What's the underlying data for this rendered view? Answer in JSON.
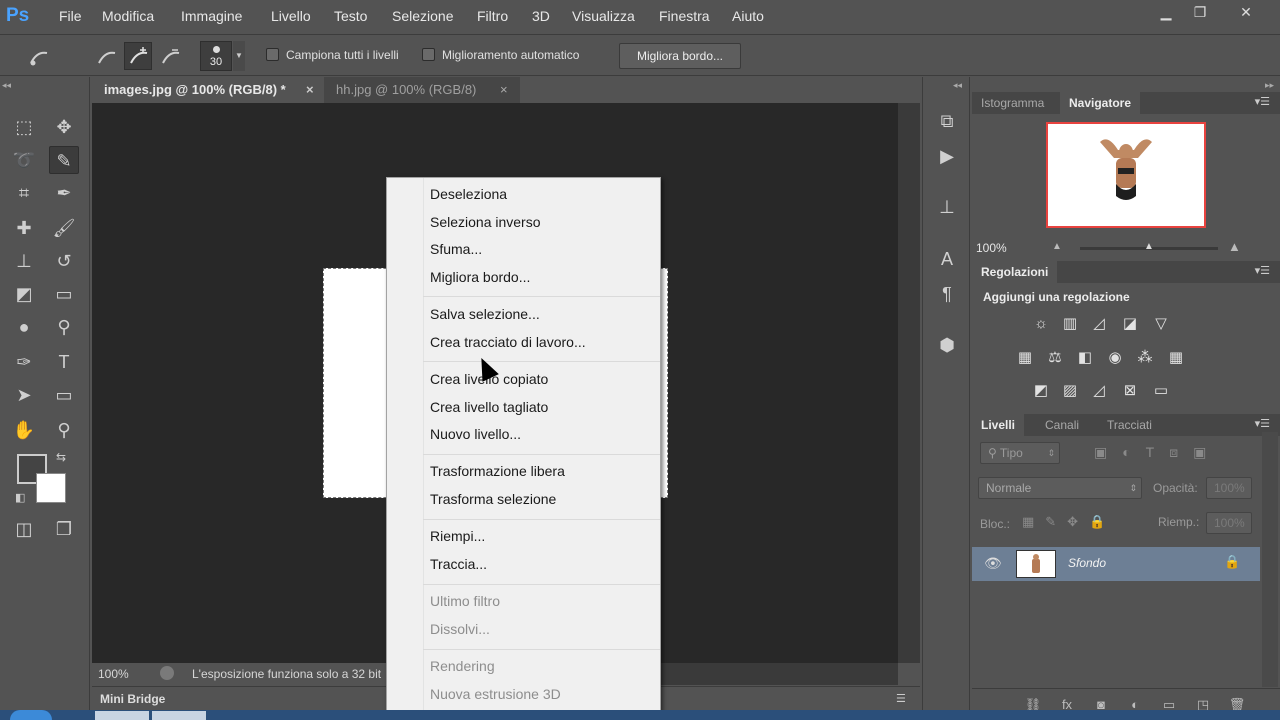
{
  "app": {
    "logo": "Ps"
  },
  "menubar": {
    "items": [
      "File",
      "Modifica",
      "Immagine",
      "Livello",
      "Testo",
      "Selezione",
      "Filtro",
      "3D",
      "Visualizza",
      "Finestra",
      "Aiuto"
    ]
  },
  "window_controls": {
    "minimize": "▁",
    "restore": "❐",
    "close": "✕"
  },
  "options": {
    "brush_size": "30",
    "sample_all_label": "Campiona tutti i livelli",
    "auto_enhance_label": "Miglioramento automatico",
    "refine_edge_button": "Migliora bordo..."
  },
  "tabs": [
    {
      "label": "images.jpg @ 100% (RGB/8) *",
      "close": "×"
    },
    {
      "label": "hh.jpg @ 100% (RGB/8)",
      "close": "×"
    }
  ],
  "status": {
    "zoom": "100%",
    "message": "L'esposizione funziona solo a 32 bit"
  },
  "mini_bridge": {
    "label": "Mini Bridge"
  },
  "context_menu": {
    "groups": [
      [
        "Deseleziona",
        "Seleziona inverso",
        "Sfuma...",
        "Migliora bordo..."
      ],
      [
        "Salva selezione...",
        "Crea tracciato di lavoro..."
      ],
      [
        "Crea livello copiato",
        "Crea livello tagliato",
        "Nuovo livello..."
      ],
      [
        "Trasformazione libera",
        "Trasforma selezione"
      ],
      [
        "Riempi...",
        "Traccia..."
      ],
      [
        "Ultimo filtro",
        "Dissolvi..."
      ],
      [
        "Rendering",
        "Nuova estrusione 3D"
      ]
    ],
    "disabled": [
      "Ultimo filtro",
      "Dissolvi...",
      "Rendering",
      "Nuova estrusione 3D"
    ]
  },
  "navigator": {
    "tabs": [
      "Istogramma",
      "Navigatore"
    ],
    "active_tab": "Navigatore",
    "zoom": "100%"
  },
  "adjustments": {
    "tab": "Regolazioni",
    "heading": "Aggiungi una regolazione"
  },
  "layers": {
    "tabs": [
      "Livelli",
      "Canali",
      "Tracciati"
    ],
    "active_tab": "Livelli",
    "filter_kind": "Tipo",
    "blend_mode": "Normale",
    "opacity_label": "Opacità:",
    "opacity_value": "100%",
    "lock_label": "Bloc.:",
    "fill_label": "Riemp.:",
    "fill_value": "100%",
    "items": [
      {
        "name": "Sfondo",
        "visible": true,
        "locked": true
      }
    ]
  },
  "colors": {
    "accent_selection": "#6d7f95",
    "thumb_border": "#e8433f",
    "ps_logo": "#4aa3ff"
  }
}
